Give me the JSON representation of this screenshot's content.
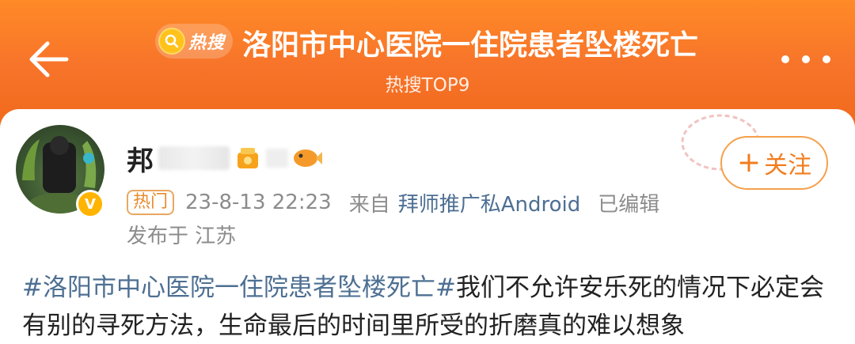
{
  "header": {
    "back_icon": "arrow-left-icon",
    "hot_badge_label": "热搜",
    "title": "洛阳市中心医院一住院患者坠楼死亡",
    "subtitle": "热搜TOP9",
    "more_icon": "more-dots-icon"
  },
  "post": {
    "username_visible": "邦",
    "tag": "热门",
    "timestamp": "23-8-13 22:23",
    "source_prefix": "来自",
    "source": "拜师推广私Android",
    "edited": "已编辑",
    "location": "发布于 江苏",
    "follow_label": "关注",
    "body_topic": "#洛阳市中心医院一住院患者坠楼死亡#",
    "body_text": "我们不允许安乐死的情况下必定会有别的寻死方法，生命最后的时间里所受的折磨真的难以想象"
  },
  "colors": {
    "header_orange": "#f7742a",
    "accent_orange": "#f27c1d",
    "link_blue": "#4d6f93",
    "verified_gold": "#ffb400"
  }
}
